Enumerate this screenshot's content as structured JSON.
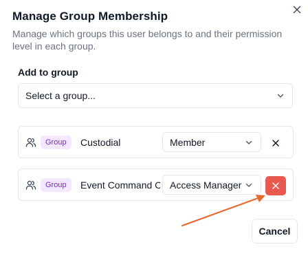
{
  "dialog": {
    "title": "Manage Group Membership",
    "description": "Manage which groups this user belongs to and their permission level in each group."
  },
  "add_section": {
    "label": "Add to group",
    "placeholder": "Select a group..."
  },
  "memberships": [
    {
      "badge": "Group",
      "name": "Custodial",
      "permission": "Member"
    },
    {
      "badge": "Group",
      "name": "Event Command C...",
      "permission": "Access Manager"
    }
  ],
  "footer": {
    "cancel_label": "Cancel"
  },
  "colors": {
    "badge_bg": "#f3e8ff",
    "badge_text": "#7e22ce",
    "remove_active": "#e8594f",
    "annotation_arrow": "#e8692d"
  },
  "icons": {
    "close": "close-icon",
    "users": "users-icon",
    "chevron": "chevron-down-icon",
    "remove": "x-icon"
  }
}
